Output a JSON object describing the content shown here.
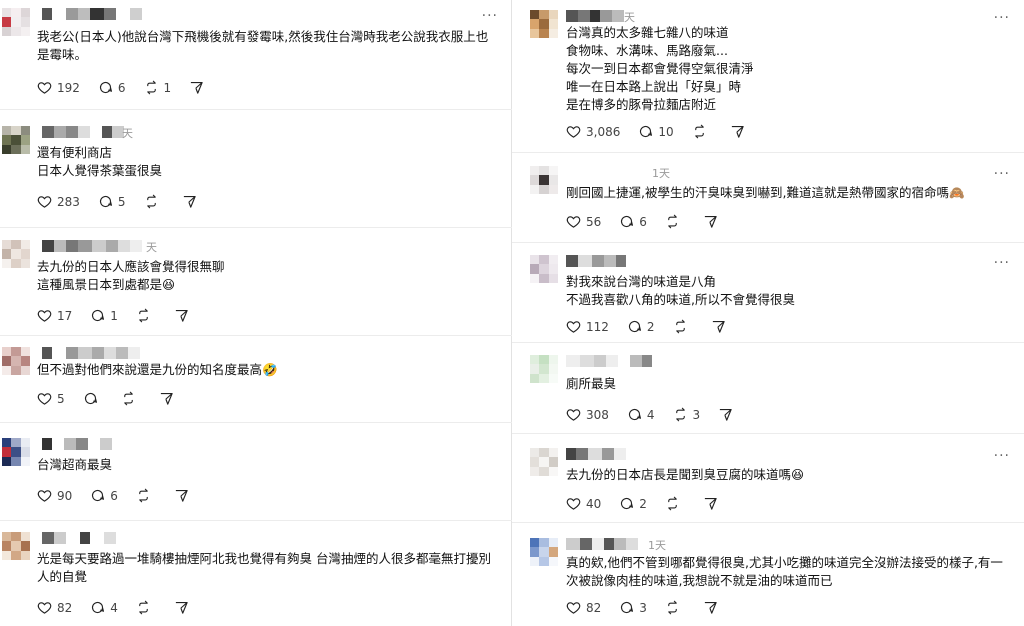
{
  "left_posts": [
    {
      "text": "我老公(日本人)他說台灣下飛機後就有發霉味,然後我住台灣時我老公說我衣服上也是霉味。",
      "time": "",
      "likes": "192",
      "replies": "6",
      "reposts": "1"
    },
    {
      "text": "還有便利商店\n日本人覺得茶葉蛋很臭",
      "time": "天",
      "likes": "283",
      "replies": "5",
      "reposts": ""
    },
    {
      "text": "去九份的日本人應該會覺得很無聊\n這種風景日本到處都是😆",
      "time": "天",
      "likes": "17",
      "replies": "1",
      "reposts": ""
    },
    {
      "text": "但不過對他們來說還是九份的知名度最高🤣",
      "time": "",
      "likes": "5",
      "replies": "",
      "reposts": ""
    },
    {
      "text": "台灣超商最臭",
      "time": "",
      "likes": "90",
      "replies": "6",
      "reposts": ""
    },
    {
      "text": "光是每天要路過一堆騎樓抽煙阿北我也覺得有夠臭 台灣抽煙的人很多都毫無打擾別人的自覺",
      "time": "",
      "likes": "82",
      "replies": "4",
      "reposts": ""
    }
  ],
  "right_posts": [
    {
      "text": "台灣真的太多雜七雜八的味道\n食物味、水溝味、馬路廢氣...\n每次一到日本都會覺得空氣很清淨\n唯一在日本路上說出「好臭」時\n是在博多的豚骨拉麵店附近",
      "time": "天",
      "likes": "3,086",
      "replies": "10",
      "reposts": ""
    },
    {
      "text": "剛回國上捷運,被學生的汗臭味臭到嚇到,難道這就是熱帶國家的宿命嗎🙈",
      "time": "1天",
      "likes": "56",
      "replies": "6",
      "reposts": ""
    },
    {
      "text": "對我來說台灣的味道是八角\n不過我喜歡八角的味道,所以不會覺得很臭",
      "time": "",
      "likes": "112",
      "replies": "2",
      "reposts": ""
    },
    {
      "text": "廁所最臭",
      "time": "",
      "likes": "308",
      "replies": "4",
      "reposts": "3"
    },
    {
      "text": "去九份的日本店長是聞到臭豆腐的味道嗎😆",
      "time": "",
      "likes": "40",
      "replies": "2",
      "reposts": ""
    },
    {
      "text": "真的欸,他們不管到哪都覺得很臭,尤其小吃攤的味道完全沒辦法接受的樣子,有一次被說像肉桂的味道,我想說不就是油的味道而已",
      "time": "1天",
      "likes": "82",
      "replies": "3",
      "reposts": ""
    }
  ],
  "icons": {
    "like": "heart-icon",
    "reply": "comment-icon",
    "repost": "repost-icon",
    "share": "send-icon",
    "more": "more-icon"
  },
  "more_glyph": "···"
}
